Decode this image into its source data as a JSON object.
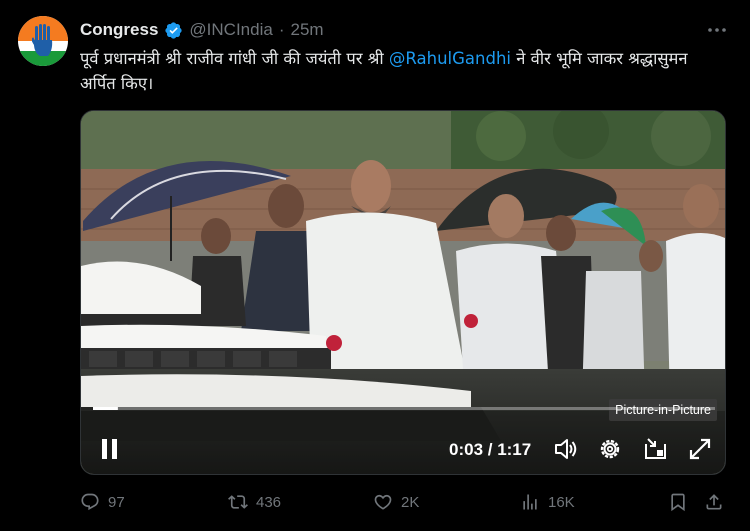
{
  "tweet": {
    "author_name": "Congress",
    "handle": "@INCIndia",
    "separator": "·",
    "time": "25m",
    "text_part1": "पूर्व प्रधानमंत्री श्री राजीव गांधी जी की जयंती पर श्री ",
    "mention": "@RahulGandhi",
    "text_part2": " ने वीर भूमि जाकर श्रद्धासुमन अर्पित किए।",
    "more_icon": "more-dots-icon"
  },
  "video": {
    "pip_label": "Picture-in-Picture",
    "timecode": "0:03 / 1:17",
    "progress_fraction": 0.04
  },
  "actions": {
    "replies": "97",
    "reposts": "436",
    "likes": "2K",
    "views": "16K"
  },
  "colors": {
    "accent": "#1d9bf0",
    "muted": "#71767b",
    "text": "#e7e9ea",
    "background": "#000000"
  }
}
